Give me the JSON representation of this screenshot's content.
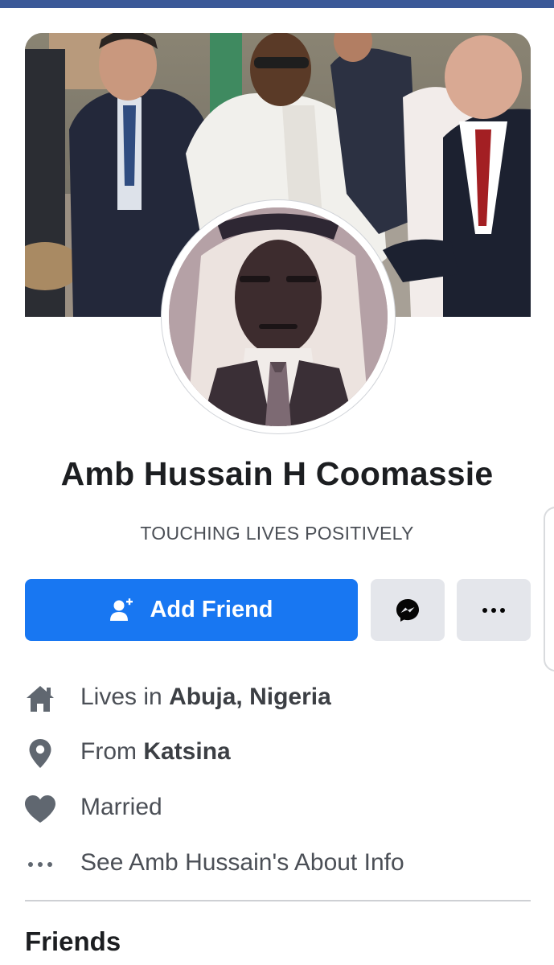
{
  "profile": {
    "name": "Amb Hussain H Coomassie",
    "bio": "TOUCHING LIVES POSITIVELY"
  },
  "actions": {
    "add_friend_label": "Add Friend",
    "messenger_icon": "messenger-icon",
    "more_icon": "more-dots-icon",
    "add_friend_icon": "add-person-icon"
  },
  "intro": {
    "lives_prefix": "Lives in ",
    "lives_value": "Abuja, Nigeria",
    "from_prefix": "From ",
    "from_value": "Katsina",
    "relationship": "Married",
    "about_link": "See Amb Hussain's About Info"
  },
  "sections": {
    "friends_title": "Friends"
  },
  "colors": {
    "top_bar": "#3b5998",
    "primary_button": "#1877f2",
    "secondary_button": "#e4e6eb",
    "icon_gray": "#65676b"
  }
}
